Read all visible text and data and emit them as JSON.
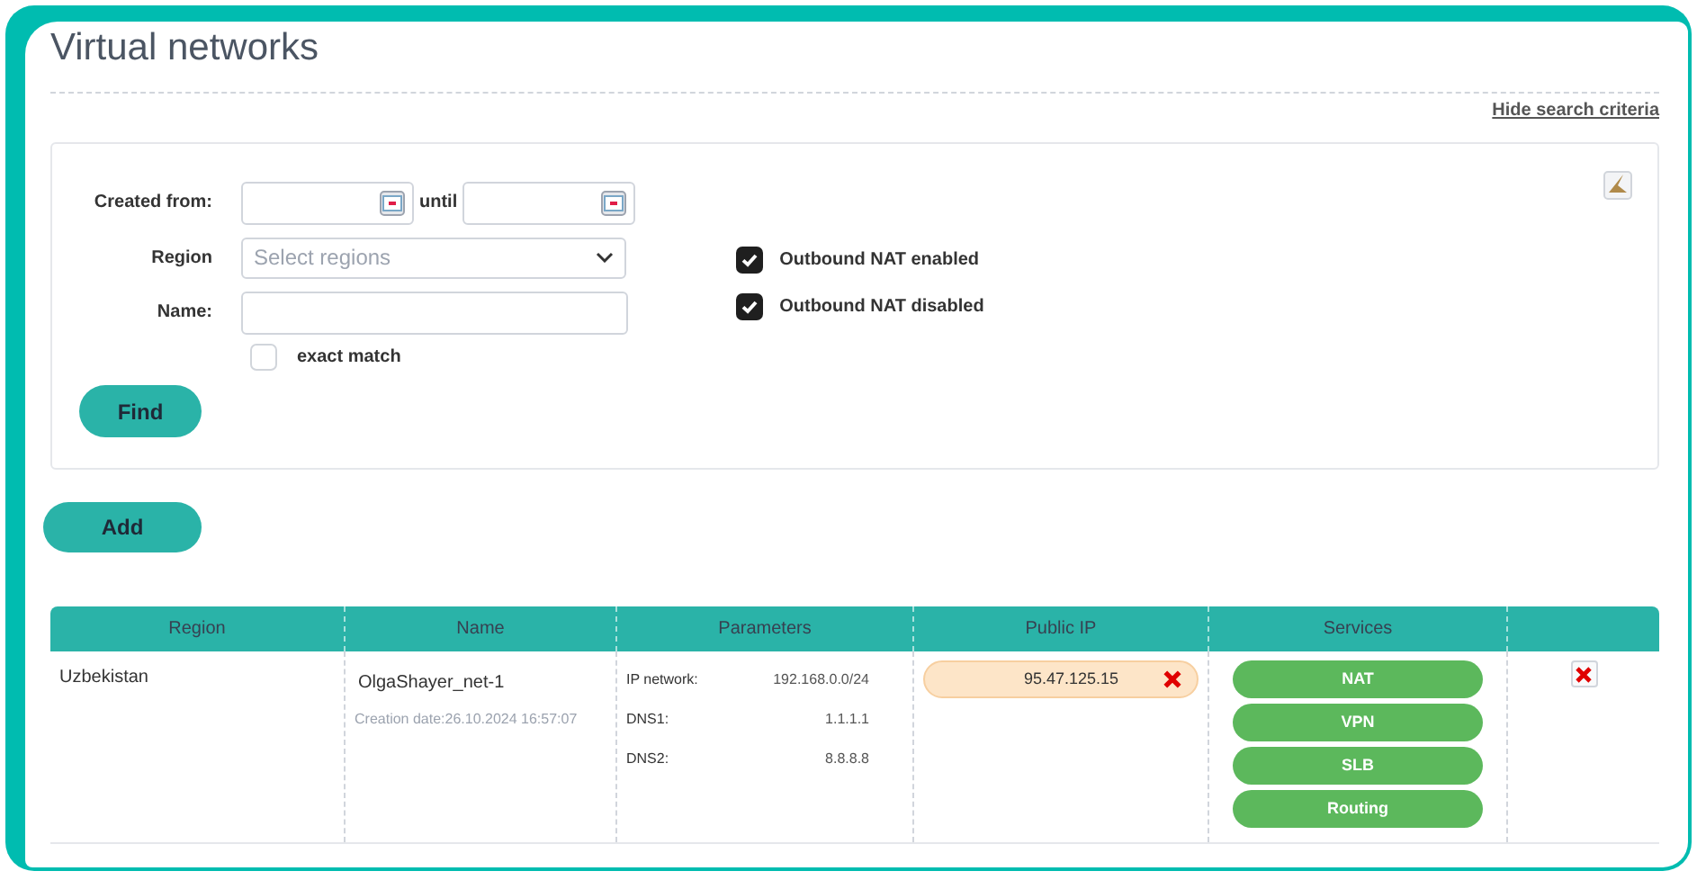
{
  "title": "Virtual networks",
  "hide_link": "Hide search criteria",
  "search": {
    "created_from_label": "Created from:",
    "until_label": "until",
    "region_label": "Region",
    "region_placeholder": "Select regions",
    "name_label": "Name:",
    "exact_match": {
      "label": "exact match",
      "checked": false
    },
    "outbound": [
      {
        "label": "Outbound NAT enabled",
        "checked": true
      },
      {
        "label": "Outbound NAT disabled",
        "checked": true
      }
    ],
    "find_button": "Find"
  },
  "add_button": "Add",
  "table": {
    "columns": [
      "Region",
      "Name",
      "Parameters",
      "Public IP",
      "Services"
    ],
    "rows": [
      {
        "region": "Uzbekistan",
        "name": "OlgaShayer_net-1",
        "created": "Creation date:26.10.2024 16:57:07",
        "parameters": [
          {
            "label": "IP network:",
            "value": "192.168.0.0/24"
          },
          {
            "label": "DNS1:",
            "value": "1.1.1.1"
          },
          {
            "label": "DNS2:",
            "value": "8.8.8.8"
          }
        ],
        "public_ip": "95.47.125.15",
        "services": [
          "NAT",
          "VPN",
          "SLB",
          "Routing"
        ]
      }
    ]
  }
}
